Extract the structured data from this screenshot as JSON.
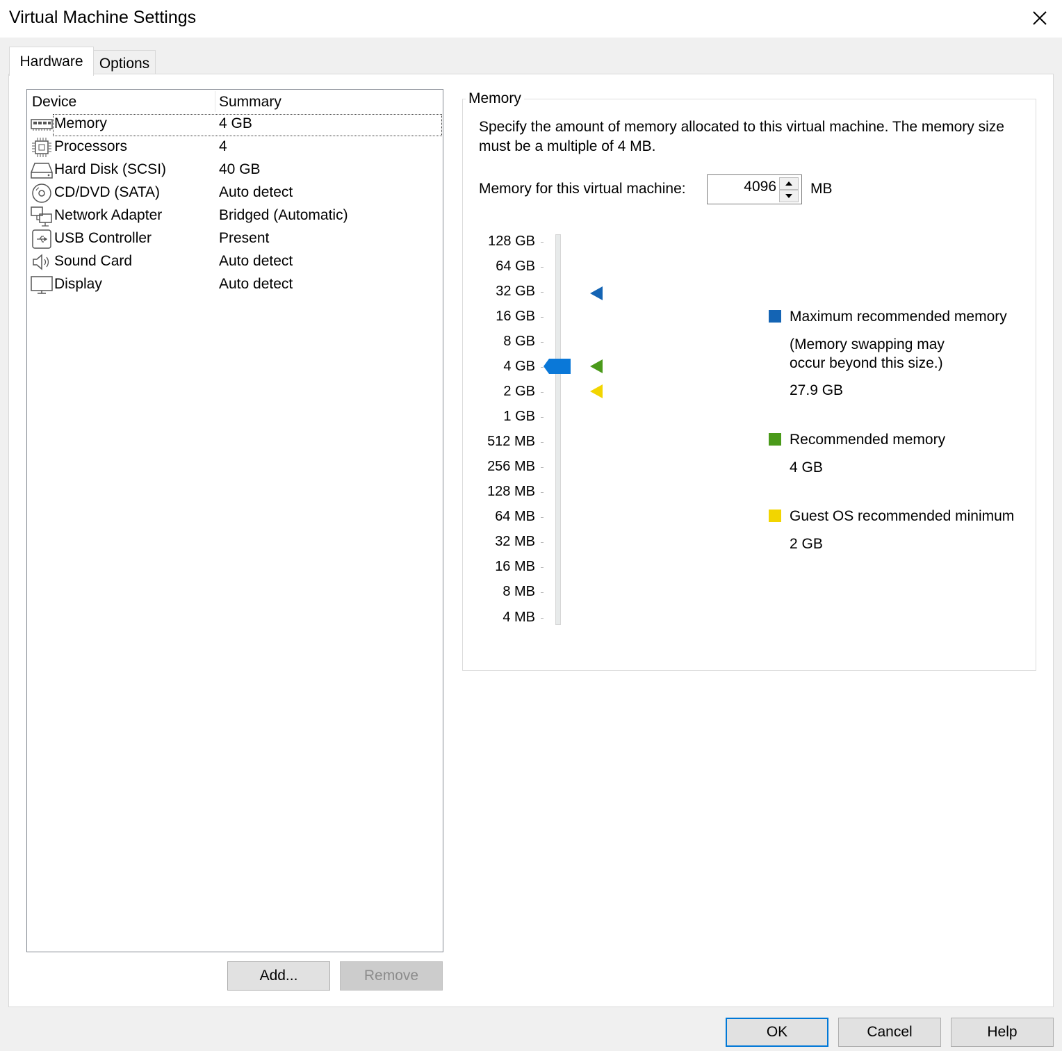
{
  "window": {
    "title": "Virtual Machine Settings",
    "close_icon": "close-icon"
  },
  "tabs": [
    {
      "label": "Hardware",
      "active": true
    },
    {
      "label": "Options",
      "active": false
    }
  ],
  "device_list": {
    "col_device": "Device",
    "col_summary": "Summary",
    "selected": "Memory",
    "rows": [
      {
        "icon": "memory-icon",
        "name": "Memory",
        "summary": "4 GB"
      },
      {
        "icon": "processor-icon",
        "name": "Processors",
        "summary": "4"
      },
      {
        "icon": "hard-disk-icon",
        "name": "Hard Disk (SCSI)",
        "summary": "40 GB"
      },
      {
        "icon": "cd-dvd-icon",
        "name": "CD/DVD (SATA)",
        "summary": "Auto detect"
      },
      {
        "icon": "network-adapter-icon",
        "name": "Network Adapter",
        "summary": "Bridged (Automatic)"
      },
      {
        "icon": "usb-icon",
        "name": "USB Controller",
        "summary": "Present"
      },
      {
        "icon": "sound-icon",
        "name": "Sound Card",
        "summary": "Auto detect"
      },
      {
        "icon": "display-icon",
        "name": "Display",
        "summary": "Auto detect"
      }
    ]
  },
  "list_buttons": {
    "add": "Add...",
    "remove": "Remove"
  },
  "memory": {
    "group_label": "Memory",
    "description": "Specify the amount of memory allocated to this virtual machine. The memory size must be a multiple of 4 MB.",
    "field_label": "Memory for this virtual machine:",
    "value": "4096",
    "unit": "MB",
    "scale_labels": [
      "128 GB",
      "64 GB",
      "32 GB",
      "16 GB",
      "8 GB",
      "4 GB",
      "2 GB",
      "1 GB",
      "512 MB",
      "256 MB",
      "128 MB",
      "64 MB",
      "32 MB",
      "16 MB",
      "8 MB",
      "4 MB"
    ],
    "slider_value": "4 GB",
    "legend": {
      "max": {
        "color": "#1464b4",
        "title": "Maximum recommended memory",
        "note_line1": "(Memory swapping may",
        "note_line2": "occur beyond this size.)",
        "value": "27.9 GB"
      },
      "recommended": {
        "color": "#4a9a1a",
        "title": "Recommended memory",
        "value": "4 GB"
      },
      "minimum": {
        "color": "#f2d500",
        "title": "Guest OS recommended minimum",
        "value": "2 GB"
      }
    }
  },
  "dialog_buttons": {
    "ok": "OK",
    "cancel": "Cancel",
    "help": "Help"
  }
}
